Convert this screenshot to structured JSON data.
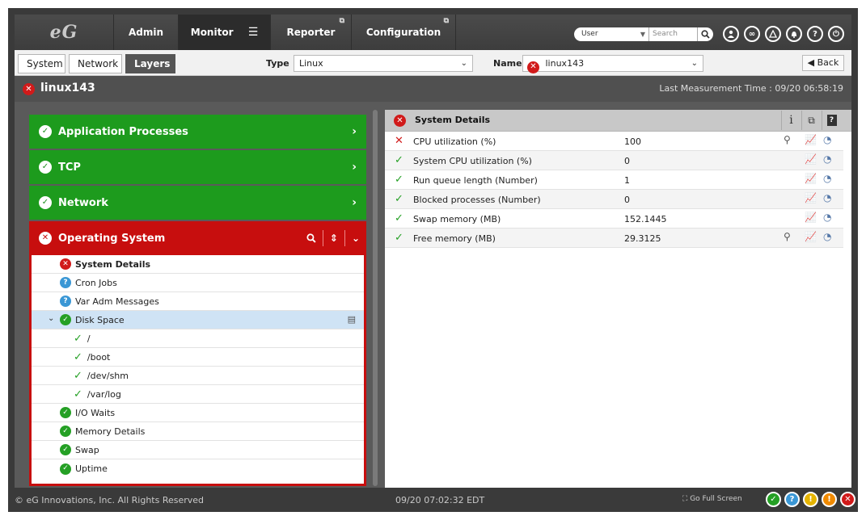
{
  "brand": {
    "logo_text": "eG"
  },
  "nav": {
    "admin": "Admin",
    "monitor": "Monitor",
    "reporter": "Reporter",
    "configuration": "Configuration"
  },
  "top_search": {
    "user_select_value": "User",
    "search_placeholder": "Search"
  },
  "top_icons": [
    "user-icon",
    "link-icon",
    "map-icon",
    "bell-icon",
    "help-icon",
    "power-icon"
  ],
  "toolbar": {
    "tabs": [
      "System",
      "Network",
      "Layers"
    ],
    "active_tab": "Layers",
    "type_label": "Type",
    "type_value": "Linux",
    "name_label": "Name",
    "name_value": "linux143",
    "back_label": "Back"
  },
  "title": {
    "component_name": "linux143",
    "last_measurement": "Last Measurement Time : 09/20 06:58:19"
  },
  "layers": [
    {
      "label": "Application Processes",
      "status": "ok"
    },
    {
      "label": "TCP",
      "status": "ok"
    },
    {
      "label": "Network",
      "status": "ok"
    },
    {
      "label": "Operating System",
      "status": "critical"
    }
  ],
  "os_tests": [
    {
      "label": "System Details",
      "status": "critical",
      "level": 0
    },
    {
      "label": "Cron Jobs",
      "status": "unknown",
      "level": 0
    },
    {
      "label": "Var Adm Messages",
      "status": "unknown",
      "level": 0
    },
    {
      "label": "Disk Space",
      "status": "ok",
      "level": 0,
      "selected": true
    },
    {
      "label": "/",
      "status": "ok",
      "level": 1
    },
    {
      "label": "/boot",
      "status": "ok",
      "level": 1
    },
    {
      "label": "/dev/shm",
      "status": "ok",
      "level": 1
    },
    {
      "label": "/var/log",
      "status": "ok",
      "level": 1
    },
    {
      "label": "I/O Waits",
      "status": "ok",
      "level": 0
    },
    {
      "label": "Memory Details",
      "status": "ok",
      "level": 0
    },
    {
      "label": "Swap",
      "status": "ok",
      "level": 0
    },
    {
      "label": "Uptime",
      "status": "ok",
      "level": 0
    }
  ],
  "details": {
    "title": "System Details",
    "metrics": [
      {
        "name": "CPU utilization (%)",
        "value": "100",
        "status": "critical",
        "has_detail": true
      },
      {
        "name": "System CPU utilization (%)",
        "value": "0",
        "status": "ok",
        "has_detail": false
      },
      {
        "name": "Run queue length (Number)",
        "value": "1",
        "status": "ok",
        "has_detail": false
      },
      {
        "name": "Blocked processes (Number)",
        "value": "0",
        "status": "ok",
        "has_detail": false
      },
      {
        "name": "Swap memory (MB)",
        "value": "152.1445",
        "status": "ok",
        "has_detail": false
      },
      {
        "name": "Free memory (MB)",
        "value": "29.3125",
        "status": "ok",
        "has_detail": true
      }
    ]
  },
  "footer": {
    "copyright": "© eG Innovations, Inc. All Rights Reserved",
    "clock": "09/20  07:02:32 EDT",
    "fullscreen": "Go Full Screen"
  },
  "colors": {
    "ok": "#25a025",
    "critical": "#c70e0e",
    "unknown": "#3a97d5",
    "warning": "#e5b400",
    "major": "#f08a00"
  }
}
